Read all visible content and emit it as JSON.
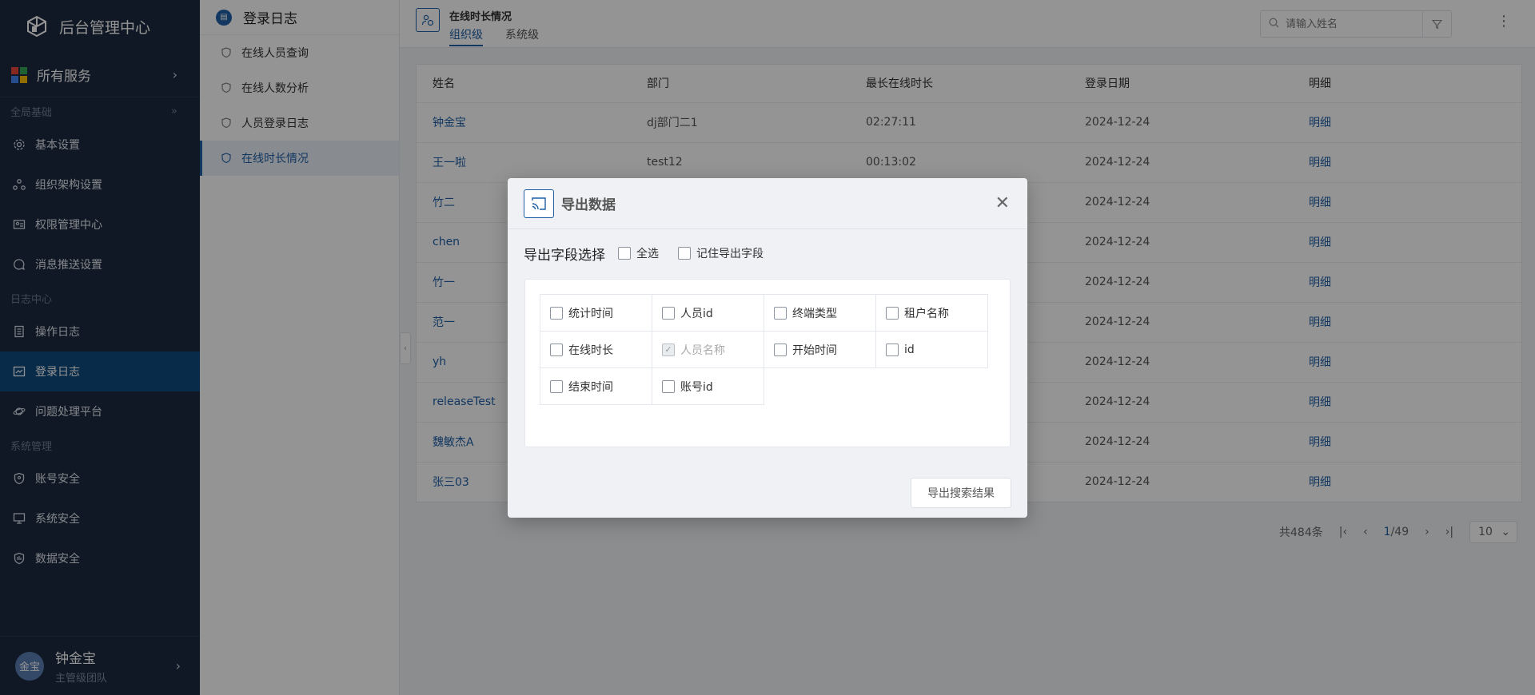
{
  "app": {
    "title": "后台管理中心"
  },
  "sidebar": {
    "all_services": "所有服务",
    "groups": [
      {
        "title": "全局基础",
        "items": [
          {
            "label": "基本设置",
            "icon": "gear-icon"
          },
          {
            "label": "组织架构设置",
            "icon": "org-icon"
          },
          {
            "label": "权限管理中心",
            "icon": "permission-icon"
          },
          {
            "label": "消息推送设置",
            "icon": "message-icon"
          }
        ]
      },
      {
        "title": "日志中心",
        "items": [
          {
            "label": "操作日志",
            "icon": "document-icon"
          },
          {
            "label": "登录日志",
            "icon": "login-log-icon",
            "active": true
          },
          {
            "label": "问题处理平台",
            "icon": "planet-icon"
          }
        ]
      },
      {
        "title": "系统管理",
        "items": [
          {
            "label": "账号安全",
            "icon": "shield-icon"
          },
          {
            "label": "系统安全",
            "icon": "monitor-icon"
          },
          {
            "label": "数据安全",
            "icon": "data-shield-icon"
          }
        ]
      }
    ],
    "user": {
      "avatar_text": "金宝",
      "name": "钟金宝",
      "role": "主管级团队"
    }
  },
  "submenu": {
    "title": "登录日志",
    "items": [
      {
        "label": "在线人员查询"
      },
      {
        "label": "在线人数分析"
      },
      {
        "label": "人员登录日志"
      },
      {
        "label": "在线时长情况",
        "active": true
      }
    ]
  },
  "page": {
    "title": "在线时长情况",
    "tabs": [
      {
        "label": "组织级",
        "active": true
      },
      {
        "label": "系统级"
      }
    ],
    "search_placeholder": "请输入姓名"
  },
  "table": {
    "headers": [
      "姓名",
      "部门",
      "最长在线时长",
      "登录日期",
      "明细"
    ],
    "rows": [
      {
        "name": "钟金宝",
        "dept": "dj部门二1",
        "duration": "02:27:11",
        "date": "2024-12-24",
        "detail": "明细"
      },
      {
        "name": "王一啦",
        "dept": "test12",
        "duration": "00:13:02",
        "date": "2024-12-24",
        "detail": "明细"
      },
      {
        "name": "竹二",
        "dept": "",
        "duration": "",
        "date": "2024-12-24",
        "detail": "明细"
      },
      {
        "name": "chen",
        "dept": "",
        "duration": "",
        "date": "2024-12-24",
        "detail": "明细"
      },
      {
        "name": "竹一",
        "dept": "",
        "duration": "",
        "date": "2024-12-24",
        "detail": "明细"
      },
      {
        "name": "范一",
        "dept": "",
        "duration": "",
        "date": "2024-12-24",
        "detail": "明细"
      },
      {
        "name": "yh",
        "dept": "",
        "duration": "",
        "date": "2024-12-24",
        "detail": "明细"
      },
      {
        "name": "releaseTest",
        "dept": "",
        "duration": "",
        "date": "2024-12-24",
        "detail": "明细"
      },
      {
        "name": "魏敏杰A",
        "dept": "",
        "duration": "",
        "date": "2024-12-24",
        "detail": "明细"
      },
      {
        "name": "张三03",
        "dept": "",
        "duration": "",
        "date": "2024-12-24",
        "detail": "明细"
      }
    ]
  },
  "pagination": {
    "total": "共484条",
    "current": "1",
    "pages": "/49",
    "page_size": "10"
  },
  "modal": {
    "title": "导出数据",
    "field_label": "导出字段选择",
    "select_all": "全选",
    "remember": "记住导出字段",
    "fields": [
      {
        "label": "统计时间",
        "checked": false
      },
      {
        "label": "人员id",
        "checked": false
      },
      {
        "label": "终端类型",
        "checked": false
      },
      {
        "label": "租户名称",
        "checked": false
      },
      {
        "label": "在线时长",
        "checked": false
      },
      {
        "label": "人员名称",
        "checked": true,
        "disabled": true
      },
      {
        "label": "开始时间",
        "checked": false
      },
      {
        "label": "id",
        "checked": false
      },
      {
        "label": "结束时间",
        "checked": false
      },
      {
        "label": "账号id",
        "checked": false
      }
    ],
    "export_button": "导出搜索结果"
  },
  "colors": {
    "sidebar_bg": "#1b2a3e",
    "active_nav": "#0f4a7e",
    "accent": "#1f5fa6"
  }
}
